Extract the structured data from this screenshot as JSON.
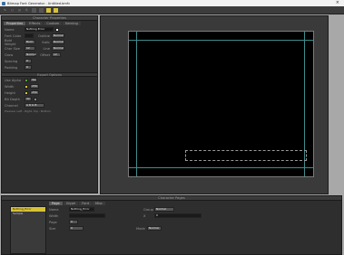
{
  "window": {
    "title": "Bitmap Font Generator - Untitled.bmfc",
    "close": "×"
  },
  "toolbar": {
    "left_labels": [
      "✎",
      "▢",
      "◫",
      "⎘"
    ],
    "items": [
      "",
      "",
      "",
      "",
      "",
      "",
      "",
      ""
    ],
    "active_indices": [
      6,
      7
    ]
  },
  "left_panel": {
    "header": "Character Properties",
    "tabs": [
      "Properties",
      "Effects",
      "Custom",
      "Kerning"
    ],
    "name_label": "Name",
    "name_value": "Nothing Error",
    "rows": [
      {
        "label": "Font Color",
        "value": "",
        "extra_label": "Outline",
        "extra": "Normal"
      },
      {
        "label": "Bold Weight",
        "value": "Bold",
        "extra_label": "Italic",
        "extra": "Normal"
      },
      {
        "label": "Char Size",
        "value": "12",
        "extra_label": "Line",
        "extra": "Normal"
      },
      {
        "label": "Grow",
        "value": "Normal",
        "extra_label": "Offset",
        "extra": "12"
      },
      {
        "label": "Spacing",
        "value": "0",
        "extra_label": "",
        "extra": ""
      },
      {
        "label": "Padding",
        "value": "0",
        "extra_label": "",
        "extra": ""
      }
    ],
    "section2": "Export Options",
    "rows2": [
      {
        "label": "Use Alpha",
        "value": "Yes"
      },
      {
        "label": "Width",
        "value": "256"
      },
      {
        "label": "Height",
        "value": "256"
      },
      {
        "label": "Bit Depth",
        "value": "32"
      },
      {
        "label": "Channel",
        "value": "A R G B"
      }
    ],
    "footer_note": "Preview: Left - Right, Top - Bottom"
  },
  "bottom": {
    "header": "Character Pages",
    "tabs": [
      "Page",
      "Glyph",
      "Font",
      "Misc"
    ],
    "list": [
      "Nothing_Error",
      "Sample"
    ],
    "name_label": "Name",
    "name_value": "Nothing_Error",
    "group_label": "Group",
    "group_value": "Normal",
    "width_label": "Width",
    "width_value": "",
    "x_label": "X",
    "x_value": "0",
    "page_label": "Page",
    "page_value": "0",
    "size_label": "Size",
    "size_value": "0",
    "mode_label": "Mode",
    "mode_value": "Normal"
  }
}
